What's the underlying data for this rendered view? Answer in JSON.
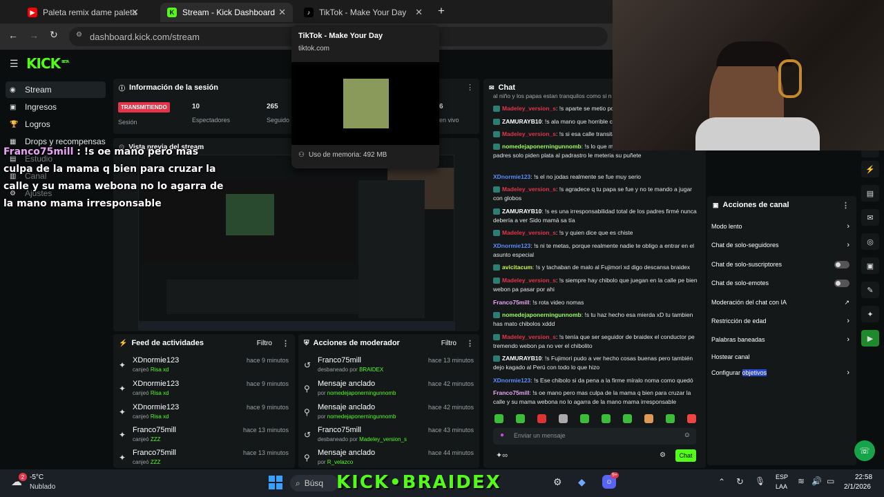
{
  "browser": {
    "tabs": [
      {
        "title": "Paleta remix dame paleta paleta",
        "icon": "youtube-icon"
      },
      {
        "title": "Stream - Kick Dashboard",
        "icon": "kick-icon"
      },
      {
        "title": "TikTok - Make Your Day",
        "icon": "tiktok-icon"
      }
    ],
    "url": "dashboard.kick.com/stream"
  },
  "tooltip": {
    "title": "TikTok - Make Your Day",
    "domain": "tiktok.com",
    "memory": "Uso de memoria: 492 MB"
  },
  "brand": {
    "logo": "KICK",
    "beta": "BETA"
  },
  "sidebar": {
    "items": [
      {
        "label": "Stream"
      },
      {
        "label": "Ingresos"
      },
      {
        "label": "Logros"
      },
      {
        "label": "Drops y recompensas"
      },
      {
        "label": "Estudio"
      },
      {
        "label": "Canal"
      },
      {
        "label": "Ajustes"
      }
    ]
  },
  "session": {
    "title": "Información de la sesión",
    "status": "TRANSMITIENDO",
    "status_label": "Sesión",
    "viewers": "10",
    "viewers_label": "Espectadores",
    "followers": "265",
    "followers_label": "Seguido",
    "right_value": "6",
    "right_label": "en vivo"
  },
  "preview": {
    "title": "Vista previa del stream"
  },
  "overlay": {
    "user": "Franco75mill",
    "lines": [
      "Franco75mill : !s oe mano pero mas",
      "culpa de la mama q bien para cruzar la",
      "calle y su mama webona no lo agarra de",
      "la mano mama irresponsable"
    ]
  },
  "activity": {
    "title": "Feed de actividades",
    "filter": "Filtro",
    "rows": [
      {
        "name": "XDnormie123",
        "action": "canjeó",
        "item": "Risa xd",
        "time": "hace 9 minutos"
      },
      {
        "name": "XDnormie123",
        "action": "canjeó",
        "item": "Risa xd",
        "time": "hace 9 minutos"
      },
      {
        "name": "XDnormie123",
        "action": "canjeó",
        "item": "Risa xd",
        "time": "hace 9 minutos"
      },
      {
        "name": "Franco75mill",
        "action": "canjeó",
        "item": "ZZZ",
        "time": "hace 13 minutos"
      },
      {
        "name": "Franco75mill",
        "action": "canjeó",
        "item": "ZZZ",
        "time": "hace 13 minutos"
      }
    ]
  },
  "moderator": {
    "title": "Acciones de moderador",
    "filter": "Filtro",
    "rows": [
      {
        "name": "Franco75mill",
        "action": "desbaneado por",
        "by": "BRAIDEX",
        "time": "hace 13 minutos"
      },
      {
        "name": "Mensaje anclado",
        "action": "por",
        "by": "nomedejaponerningunnomb",
        "time": "hace 42 minutos"
      },
      {
        "name": "Mensaje anclado",
        "action": "por",
        "by": "nomedejaponerningunnomb",
        "time": "hace 42 minutos"
      },
      {
        "name": "Franco75mill",
        "action": "desbaneado por",
        "by": "Madeley_version_s",
        "time": "hace 43 minutos"
      },
      {
        "name": "Mensaje anclado",
        "action": "por",
        "by": "R_velazco",
        "time": "hace 44 minutos"
      }
    ]
  },
  "chat": {
    "title": "Chat",
    "top_line": "al niño y los papas estan tranquilos como si n",
    "messages": [
      {
        "user": "Madeley_version_s",
        "color": "red",
        "text": "!s aparte se metio po"
      },
      {
        "user": "ZAMURAYB10",
        "color": "white",
        "text": "!s ala mano que horrible c"
      },
      {
        "user": "Madeley_version_s",
        "color": "red",
        "text": "!s si esa calle transita"
      },
      {
        "user": "nomedejaponerningunnomb",
        "color": "green",
        "text": "!s lo que m muertos de hambres de los padres solo piden plata al padrastro le meteria su puñete"
      },
      {
        "user": "XDnormie123",
        "color": "blue",
        "text": "!s el no jodas realmente se fue muy serio"
      },
      {
        "user": "Madeley_version_s",
        "color": "red",
        "text": "!s agradece q tu papa se fue y no te mando a jugar con globos"
      },
      {
        "user": "ZAMURAYB10",
        "color": "white",
        "text": "!s es una irresponsabilidad total de los padres firmé nunca debería a ver Sido mamá sa tía"
      },
      {
        "user": "Madeley_version_s",
        "color": "red",
        "text": "!s y quien dice que es chiste"
      },
      {
        "user": "XDnormie123",
        "color": "blue",
        "text": "!s ni te metas, porque realmente nadie te obligo a entrar en el asunto especial"
      },
      {
        "user": "avicitacum",
        "color": "lime",
        "text": "!s y tachaban de malo al Fujimori xd digo descansa braidex"
      },
      {
        "user": "Madeley_version_s",
        "color": "red",
        "text": "!s siempre hay chibolo que juegan en la calle pe bien webon pa pasar por ahi"
      },
      {
        "user": "Franco75mill",
        "color": "pink",
        "text": "!s rota video nomas"
      },
      {
        "user": "nomedejaponerningunnomb",
        "color": "green",
        "text": "!s tu haz hecho esa mierda xD tu tambien has mato chibolos xddd"
      },
      {
        "user": "Madeley_version_s",
        "color": "red",
        "text": "!s tenía que ser seguidor de braidex el conductor pe tremendo webon pa no ver el chibolito"
      },
      {
        "user": "ZAMURAYB10",
        "color": "white",
        "text": "!s Fujimori pudo a ver hecho cosas buenas pero también dejo kagado al Perú con todo lo que hizo"
      },
      {
        "user": "XDnormie123",
        "color": "blue",
        "text": "!s Ese chibolo si da pena a la firme míralo noma como quedó"
      },
      {
        "user": "Franco75mill",
        "color": "pink",
        "text": "!s oe mano pero mas culpa de la mama q bien para cruzar la calle y su mama webona no lo agarra de la mano mama irresponsable"
      }
    ],
    "input_placeholder": "Enviar un mensaje",
    "send_label": "Chat"
  },
  "channel_actions": {
    "title": "Acciones de canal",
    "items": [
      {
        "label": "Modo lento",
        "kind": "arrow"
      },
      {
        "label": "Chat de solo-seguidores",
        "kind": "arrow"
      },
      {
        "label": "Chat de solo-suscriptores",
        "kind": "toggle"
      },
      {
        "label": "Chat de solo-emotes",
        "kind": "toggle"
      },
      {
        "label": "Moderación del chat con IA",
        "kind": "external"
      },
      {
        "label": "Restricción de edad",
        "kind": "arrow"
      },
      {
        "label": "Palabras baneadas",
        "kind": "arrow"
      },
      {
        "label": "Hostear canal",
        "kind": "none"
      },
      {
        "label": "Configurar",
        "highlight": "objetivos",
        "kind": "arrow"
      }
    ]
  },
  "taskbar": {
    "weather_temp": "-5°C",
    "weather_desc": "Nublado",
    "weather_badge": "2",
    "search": "Búsq",
    "watermark": "KICK•BRAIDEX",
    "lang1": "ESP",
    "lang2": "LAA",
    "time": "22:58",
    "date": "2/1/2026",
    "discord_badge": "9+"
  },
  "colors": {
    "kick_green": "#53fc18",
    "live_red": "#e3344a",
    "panel": "#141819"
  }
}
